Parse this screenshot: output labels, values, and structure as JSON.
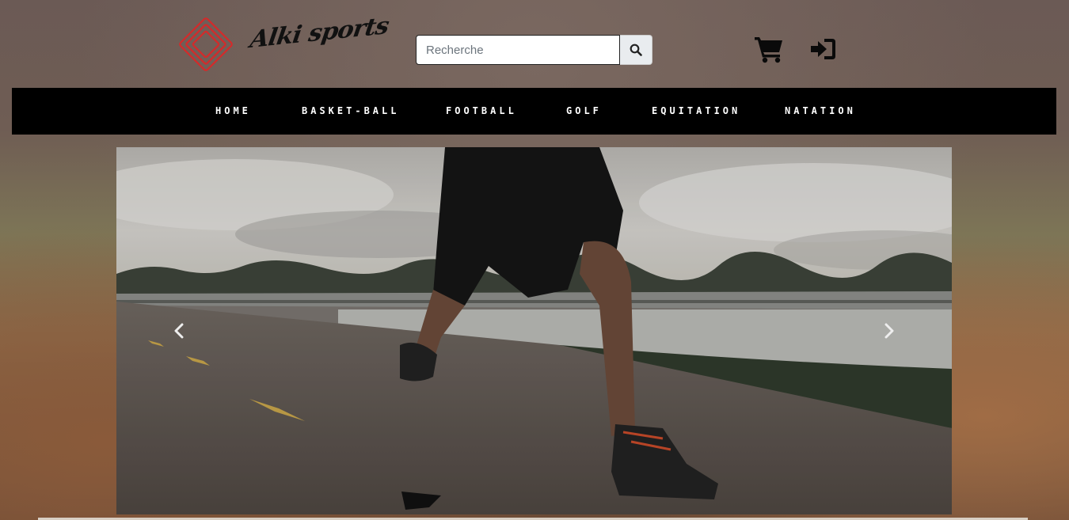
{
  "header": {
    "logo_text": "Alki sports",
    "search": {
      "placeholder": "Recherche",
      "value": ""
    },
    "icons": {
      "search": "search-icon",
      "cart": "shopping-cart-icon",
      "login": "sign-in-icon"
    }
  },
  "nav": {
    "items": [
      {
        "label": "HOME"
      },
      {
        "label": "BASKET-BALL"
      },
      {
        "label": "FOOTBALL"
      },
      {
        "label": "GOLF"
      },
      {
        "label": "EQUITATION"
      },
      {
        "label": "NATATION"
      }
    ]
  },
  "carousel": {
    "prev_icon": "chevron-left-icon",
    "next_icon": "chevron-right-icon"
  },
  "colors": {
    "navbar_bg": "#000000",
    "logo_red": "#d42a2a",
    "nav_text": "#ffffff"
  }
}
